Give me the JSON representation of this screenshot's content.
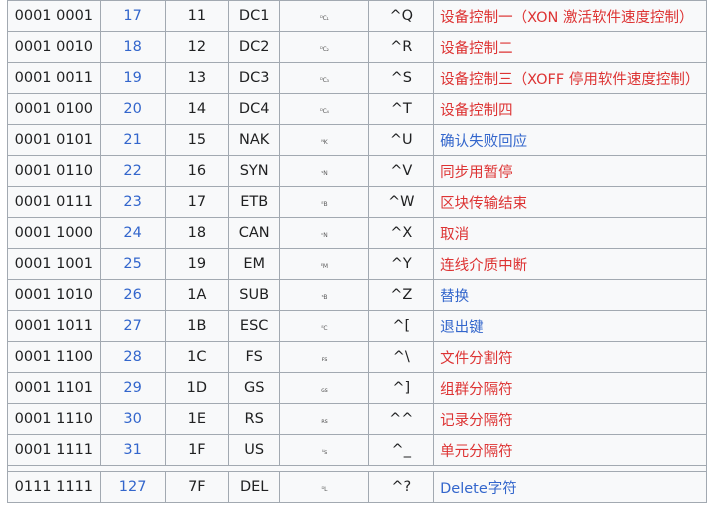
{
  "colors": {
    "link_blue": "#3366cc",
    "link_red": "#d33",
    "border": "#a2a9b1",
    "cell_bg": "#f8f9fa"
  },
  "rows": [
    {
      "bin": "0001 0001",
      "dec": "17",
      "hex": "11",
      "abbr": "DC1",
      "sym": "ᴰC₁",
      "caret": "^Q",
      "desc": "设备控制一（XON 激活软件速度控制）",
      "desc_color": "red"
    },
    {
      "bin": "0001 0010",
      "dec": "18",
      "hex": "12",
      "abbr": "DC2",
      "sym": "ᴰC₂",
      "caret": "^R",
      "desc": "设备控制二",
      "desc_color": "red"
    },
    {
      "bin": "0001 0011",
      "dec": "19",
      "hex": "13",
      "abbr": "DC3",
      "sym": "ᴰC₃",
      "caret": "^S",
      "desc": "设备控制三（XOFF 停用软件速度控制）",
      "desc_color": "red"
    },
    {
      "bin": "0001 0100",
      "dec": "20",
      "hex": "14",
      "abbr": "DC4",
      "sym": "ᴰC₄",
      "caret": "^T",
      "desc": "设备控制四",
      "desc_color": "red"
    },
    {
      "bin": "0001 0101",
      "dec": "21",
      "hex": "15",
      "abbr": "NAK",
      "sym": "ᴺK",
      "caret": "^U",
      "desc": "确认失败回应",
      "desc_color": "blue"
    },
    {
      "bin": "0001 0110",
      "dec": "22",
      "hex": "16",
      "abbr": "SYN",
      "sym": "ˢN",
      "caret": "^V",
      "desc": "同步用暂停",
      "desc_color": "red"
    },
    {
      "bin": "0001 0111",
      "dec": "23",
      "hex": "17",
      "abbr": "ETB",
      "sym": "ᴱB",
      "caret": "^W",
      "desc": "区块传输结束",
      "desc_color": "red"
    },
    {
      "bin": "0001 1000",
      "dec": "24",
      "hex": "18",
      "abbr": "CAN",
      "sym": "ᶜN",
      "caret": "^X",
      "desc": "取消",
      "desc_color": "red"
    },
    {
      "bin": "0001 1001",
      "dec": "25",
      "hex": "19",
      "abbr": "EM",
      "sym": "ᴱM",
      "caret": "^Y",
      "desc": "连线介质中断",
      "desc_color": "red"
    },
    {
      "bin": "0001 1010",
      "dec": "26",
      "hex": "1A",
      "abbr": "SUB",
      "sym": "ˢB",
      "caret": "^Z",
      "desc": "替换",
      "desc_color": "blue"
    },
    {
      "bin": "0001 1011",
      "dec": "27",
      "hex": "1B",
      "abbr": "ESC",
      "sym": "ᴱC",
      "caret": "^[",
      "desc": "退出键",
      "desc_color": "blue"
    },
    {
      "bin": "0001 1100",
      "dec": "28",
      "hex": "1C",
      "abbr": "FS",
      "sym": "ꜰs",
      "caret": "^\\",
      "desc": "文件分割符",
      "desc_color": "red"
    },
    {
      "bin": "0001 1101",
      "dec": "29",
      "hex": "1D",
      "abbr": "GS",
      "sym": "ɢs",
      "caret": "^]",
      "desc": "组群分隔符",
      "desc_color": "red"
    },
    {
      "bin": "0001 1110",
      "dec": "30",
      "hex": "1E",
      "abbr": "RS",
      "sym": "ʀs",
      "caret": "^^",
      "desc": "记录分隔符",
      "desc_color": "red"
    },
    {
      "bin": "0001 1111",
      "dec": "31",
      "hex": "1F",
      "abbr": "US",
      "sym": "ᵁs",
      "caret": "^_",
      "desc": "单元分隔符",
      "desc_color": "red"
    }
  ],
  "last_row": {
    "bin": "0111 1111",
    "dec": "127",
    "hex": "7F",
    "abbr": "DEL",
    "sym": "ᴰL",
    "caret": "^?",
    "desc": "Delete字符",
    "desc_color": "blue"
  }
}
